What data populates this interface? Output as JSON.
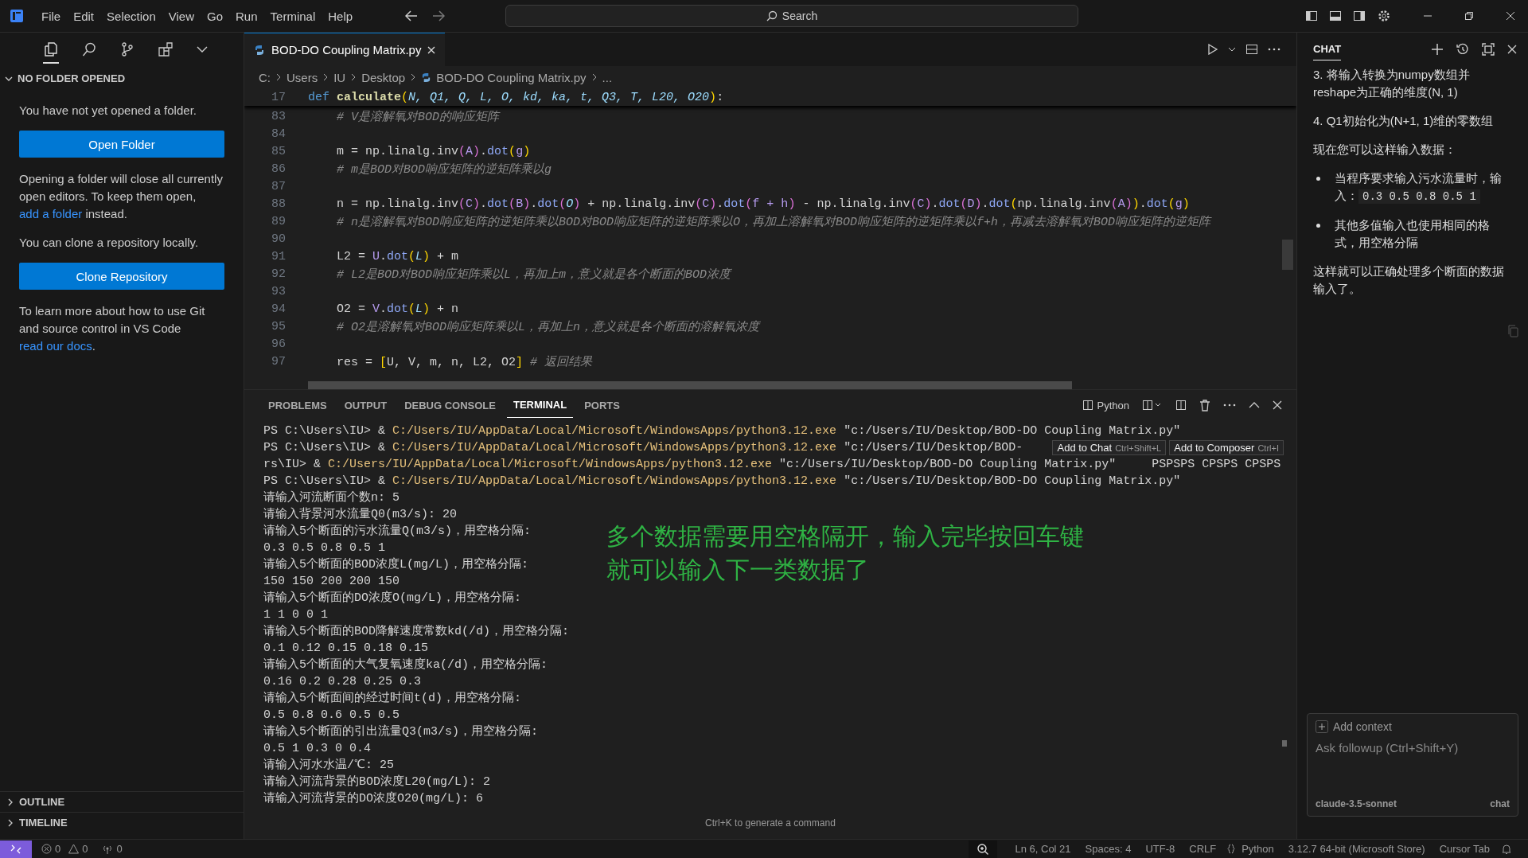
{
  "menu": [
    "File",
    "Edit",
    "Selection",
    "View",
    "Go",
    "Run",
    "Terminal",
    "Help"
  ],
  "search": {
    "placeholder": "Search"
  },
  "sidebar": {
    "title": "NO FOLDER OPENED",
    "message": "You have not yet opened a folder.",
    "open_button": "Open Folder",
    "note_before": "Opening a folder will close all currently open editors. To keep them open, ",
    "note_link": "add a folder",
    "note_after": " instead.",
    "clone_text": "You can clone a repository locally.",
    "clone_button": "Clone Repository",
    "learn_before": "To learn more about how to use Git and source control in VS Code ",
    "learn_link": "read our docs",
    "learn_after": ".",
    "sections": [
      "OUTLINE",
      "TIMELINE"
    ]
  },
  "editor": {
    "tab": "BOD-DO Coupling Matrix.py",
    "breadcrumb": [
      "C:",
      "Users",
      "IU",
      "Desktop",
      "BOD-DO Coupling Matrix.py",
      "..."
    ],
    "sticky_line": {
      "n": "17",
      "tokens": [
        {
          "text": "def ",
          "kind": "kw"
        },
        {
          "text": "calculate",
          "kind": "fn"
        },
        {
          "text": "(",
          "kind": "br"
        },
        {
          "text": "N, Q1, Q, L, O, kd, ka, t, Q3, T, L20, O20",
          "kind": "pa"
        },
        {
          "text": ")",
          "kind": "br"
        },
        {
          "text": ":",
          "kind": "pl"
        }
      ]
    },
    "lines": [
      {
        "n": "83",
        "tokens": [
          {
            "text": "    # V是溶解氧对BOD的响应矩阵",
            "kind": "cm"
          }
        ]
      },
      {
        "n": "84"
      },
      {
        "n": "85",
        "tokens": [
          {
            "text": "    m = np.linalg.inv",
            "kind": "pl"
          },
          {
            "text": "(",
            "kind": "bp"
          },
          {
            "text": "A",
            "kind": "v"
          },
          {
            "text": ")",
            "kind": "bp"
          },
          {
            "text": ".",
            "kind": "pl"
          },
          {
            "text": "dot",
            "kind": "me"
          },
          {
            "text": "(",
            "kind": "br"
          },
          {
            "text": "g",
            "kind": "v"
          },
          {
            "text": ")",
            "kind": "br"
          }
        ]
      },
      {
        "n": "86",
        "tokens": [
          {
            "text": "    # m是BOD对BOD响应矩阵的逆矩阵乘以g",
            "kind": "cm"
          }
        ]
      },
      {
        "n": "87"
      },
      {
        "n": "88",
        "tokens": [
          {
            "text": "    n = np.linalg.inv",
            "kind": "pl"
          },
          {
            "text": "(",
            "kind": "bp"
          },
          {
            "text": "C",
            "kind": "v"
          },
          {
            "text": ")",
            "kind": "bp"
          },
          {
            "text": ".",
            "kind": "pl"
          },
          {
            "text": "dot",
            "kind": "me"
          },
          {
            "text": "(",
            "kind": "bp"
          },
          {
            "text": "B",
            "kind": "v"
          },
          {
            "text": ")",
            "kind": "bp"
          },
          {
            "text": ".",
            "kind": "pl"
          },
          {
            "text": "dot",
            "kind": "me"
          },
          {
            "text": "(",
            "kind": "bp"
          },
          {
            "text": "O",
            "kind": "pa"
          },
          {
            "text": ")",
            "kind": "bp"
          },
          {
            "text": " + np.linalg.inv",
            "kind": "pl"
          },
          {
            "text": "(",
            "kind": "bp"
          },
          {
            "text": "C",
            "kind": "v"
          },
          {
            "text": ")",
            "kind": "bp"
          },
          {
            "text": ".",
            "kind": "pl"
          },
          {
            "text": "dot",
            "kind": "me"
          },
          {
            "text": "(",
            "kind": "bp"
          },
          {
            "text": "f + h",
            "kind": "v"
          },
          {
            "text": ")",
            "kind": "bp"
          },
          {
            "text": " - np.linalg.inv",
            "kind": "pl"
          },
          {
            "text": "(",
            "kind": "bp"
          },
          {
            "text": "C",
            "kind": "v"
          },
          {
            "text": ")",
            "kind": "bp"
          },
          {
            "text": ".",
            "kind": "pl"
          },
          {
            "text": "dot",
            "kind": "me"
          },
          {
            "text": "(",
            "kind": "bp"
          },
          {
            "text": "D",
            "kind": "v"
          },
          {
            "text": ")",
            "kind": "bp"
          },
          {
            "text": ".",
            "kind": "pl"
          },
          {
            "text": "dot",
            "kind": "me"
          },
          {
            "text": "(",
            "kind": "br"
          },
          {
            "text": "np.linalg.inv",
            "kind": "pl"
          },
          {
            "text": "(",
            "kind": "bp"
          },
          {
            "text": "A",
            "kind": "v"
          },
          {
            "text": ")",
            "kind": "bp"
          },
          {
            "text": ")",
            "kind": "br"
          },
          {
            "text": ".",
            "kind": "pl"
          },
          {
            "text": "dot",
            "kind": "me"
          },
          {
            "text": "(",
            "kind": "br"
          },
          {
            "text": "g",
            "kind": "v"
          },
          {
            "text": ")",
            "kind": "br"
          }
        ]
      },
      {
        "n": "89",
        "tokens": [
          {
            "text": "    # n是溶解氧对BOD响应矩阵的逆矩阵乘以BOD对BOD响应矩阵的逆矩阵乘以O，再加上溶解氧对BOD响应矩阵的逆矩阵乘以f+h，再减去溶解氧对BOD响应矩阵的逆矩阵",
            "kind": "cm"
          }
        ]
      },
      {
        "n": "90"
      },
      {
        "n": "91",
        "tokens": [
          {
            "text": "    L2 = ",
            "kind": "pl"
          },
          {
            "text": "U",
            "kind": "v"
          },
          {
            "text": ".",
            "kind": "pl"
          },
          {
            "text": "dot",
            "kind": "me"
          },
          {
            "text": "(",
            "kind": "br"
          },
          {
            "text": "L",
            "kind": "pa"
          },
          {
            "text": ")",
            "kind": "br"
          },
          {
            "text": " + m",
            "kind": "pl"
          }
        ]
      },
      {
        "n": "92",
        "tokens": [
          {
            "text": "    # L2是BOD对BOD响应矩阵乘以L，再加上m，意义就是各个断面的BOD浓度",
            "kind": "cm"
          }
        ]
      },
      {
        "n": "93"
      },
      {
        "n": "94",
        "tokens": [
          {
            "text": "    O2 = ",
            "kind": "pl"
          },
          {
            "text": "V",
            "kind": "v"
          },
          {
            "text": ".",
            "kind": "pl"
          },
          {
            "text": "dot",
            "kind": "me"
          },
          {
            "text": "(",
            "kind": "br"
          },
          {
            "text": "L",
            "kind": "pa"
          },
          {
            "text": ")",
            "kind": "br"
          },
          {
            "text": " + n",
            "kind": "pl"
          }
        ]
      },
      {
        "n": "95",
        "tokens": [
          {
            "text": "    # O2是溶解氧对BOD响应矩阵乘以L，再加上n，意义就是各个断面的溶解氧浓度",
            "kind": "cm"
          }
        ]
      },
      {
        "n": "96"
      },
      {
        "n": "97",
        "tokens": [
          {
            "text": "    res = ",
            "kind": "pl"
          },
          {
            "text": "[",
            "kind": "br"
          },
          {
            "text": "U, V, m, n, L2, O2",
            "kind": "pl"
          },
          {
            "text": "]",
            "kind": "br"
          },
          {
            "text": " # 返回结果",
            "kind": "cm"
          }
        ]
      }
    ]
  },
  "panel": {
    "tabs": [
      {
        "label": "PROBLEMS",
        "selected": false
      },
      {
        "label": "OUTPUT",
        "selected": false
      },
      {
        "label": "DEBUG CONSOLE",
        "selected": false
      },
      {
        "label": "TERMINAL",
        "selected": true
      },
      {
        "label": "PORTS",
        "selected": false
      }
    ],
    "shell": "Python",
    "terminal": [
      [
        {
          "text": "PS C:\\Users\\IU> & ",
          "kind": "pl"
        },
        {
          "text": "C:/Users/IU/AppData/Local/Microsoft/WindowsApps/python3.12.exe",
          "kind": "ex"
        },
        {
          "text": " \"c:/Users/IU/Desktop/BOD-DO Coupling Matrix.py\"",
          "kind": "pl"
        }
      ],
      [
        {
          "text": "PS C:\\Users\\IU> & ",
          "kind": "pl"
        },
        {
          "text": "C:/Users/IU/AppData/Local/Microsoft/WindowsApps/python3.12.exe",
          "kind": "ex"
        },
        {
          "text": " \"c:/Users/IU/Desktop/BOD-",
          "kind": "pl"
        }
      ],
      [
        {
          "text": "rs\\IU> & ",
          "kind": "pl"
        },
        {
          "text": "C:/Users/IU/AppData/Local/Microsoft/WindowsApps/python3.12.exe",
          "kind": "ex"
        },
        {
          "text": " \"c:/Users/IU/Desktop/BOD-DO Coupling Matrix.py\"     PSPSPS CPSPS CPSPS",
          "kind": "pl"
        }
      ],
      [
        {
          "text": "PS C:\\Users\\IU> & ",
          "kind": "pl"
        },
        {
          "text": "C:/Users/IU/AppData/Local/Microsoft/WindowsApps/python3.12.exe",
          "kind": "ex"
        },
        {
          "text": " \"c:/Users/IU/Desktop/BOD-DO Coupling Matrix.py\"",
          "kind": "pl"
        }
      ],
      [
        {
          "text": "请输入河流断面个数n: 5",
          "kind": "pl"
        }
      ],
      [
        {
          "text": "请输入背景河水流量Q0(m3/s): 20",
          "kind": "pl"
        }
      ],
      [
        {
          "text": "请输入5个断面的污水流量Q(m3/s)，用空格分隔:",
          "kind": "pl"
        }
      ],
      [
        {
          "text": "0.3 0.5 0.8 0.5 1",
          "kind": "pl"
        }
      ],
      [
        {
          "text": "请输入5个断面的BOD浓度L(mg/L)，用空格分隔:",
          "kind": "pl"
        }
      ],
      [
        {
          "text": "150 150 200 200 150",
          "kind": "pl"
        }
      ],
      [
        {
          "text": "请输入5个断面的DO浓度O(mg/L)，用空格分隔:",
          "kind": "pl"
        }
      ],
      [
        {
          "text": "1 1 0 0 1",
          "kind": "pl"
        }
      ],
      [
        {
          "text": "请输入5个断面的BOD降解速度常数kd(/d)，用空格分隔:",
          "kind": "pl"
        }
      ],
      [
        {
          "text": "0.1 0.12 0.15 0.18 0.15",
          "kind": "pl"
        }
      ],
      [
        {
          "text": "请输入5个断面的大气复氧速度ka(/d)，用空格分隔:",
          "kind": "pl"
        }
      ],
      [
        {
          "text": "0.16 0.2 0.28 0.25 0.3",
          "kind": "pl"
        }
      ],
      [
        {
          "text": "请输入5个断面间的经过时间t(d)，用空格分隔:",
          "kind": "pl"
        }
      ],
      [
        {
          "text": "0.5 0.8 0.6 0.5 0.5",
          "kind": "pl"
        }
      ],
      [
        {
          "text": "请输入5个断面的引出流量Q3(m3/s)，用空格分隔:",
          "kind": "pl"
        }
      ],
      [
        {
          "text": "0.5 1 0.3 0 0.4",
          "kind": "pl"
        }
      ],
      [
        {
          "text": "请输入河水水温/℃: 25",
          "kind": "pl"
        }
      ],
      [
        {
          "text": "请输入河流背景的BOD浓度L20(mg/L): 2",
          "kind": "pl"
        }
      ],
      [
        {
          "text": "请输入河流背景的DO浓度O20(mg/L): 6",
          "kind": "pl"
        }
      ]
    ],
    "hovers": [
      {
        "label": "Add to Chat",
        "shortcut": "Ctrl+Shift+L"
      },
      {
        "label": "Add to Composer",
        "shortcut": "Ctrl+I"
      }
    ],
    "annotation": [
      "多个数据需要用空格隔开，输入完毕按回车键",
      "就可以输入下一类数据了"
    ],
    "hint": "Ctrl+K to generate a command"
  },
  "chat": {
    "title": "CHAT",
    "messages": [
      {
        "kind": "para",
        "text": "3. 将输入转换为numpy数组并reshape为正确的维度(N, 1)"
      },
      {
        "kind": "para",
        "text": "4. Q1初始化为(N+1, 1)维的零数组"
      },
      {
        "kind": "para",
        "text": "现在您可以这样输入数据："
      },
      {
        "kind": "bullet",
        "text": "当程序要求输入污水流量时，输入：",
        "code": "0.3 0.5 0.8 0.5 1"
      },
      {
        "kind": "bullet",
        "text": "其他多值输入也使用相同的格式，用空格分隔"
      },
      {
        "kind": "para",
        "text": "这样就可以正确处理多个断面的数据输入了。"
      }
    ],
    "input": {
      "context": "Add context",
      "placeholder": "Ask followup (Ctrl+Shift+Y)",
      "model": "claude-3.5-sonnet",
      "send": "chat"
    }
  },
  "status_bar": {
    "errors": "0",
    "warnings": "0",
    "ports": "0",
    "items": [
      "Ln 6, Col 21",
      "Spaces: 4",
      "UTF-8",
      "CRLF",
      "Python",
      "3.12.7 64-bit (Microsoft Store)",
      "Cursor Tab"
    ]
  }
}
